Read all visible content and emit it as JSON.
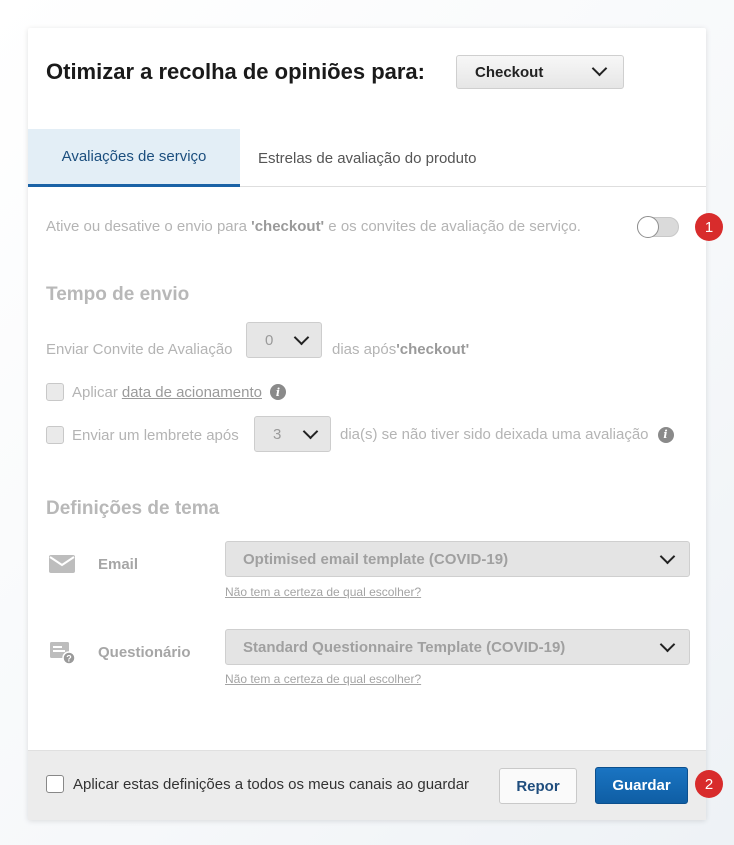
{
  "header": {
    "title": "Otimizar a recolha de opiniões para:",
    "channel_select": "Checkout"
  },
  "tabs": [
    {
      "label": "Avaliações de serviço"
    },
    {
      "label": "Estrelas de avaliação do produto"
    }
  ],
  "toggle_row": {
    "text_before": "Ative ou desative o envio para ",
    "bold": "'checkout'",
    "text_after": " e os convites de avaliação de serviço.",
    "enabled": false
  },
  "badges": {
    "first": "1",
    "second": "2"
  },
  "send_time": {
    "section_title": "Tempo de envio",
    "invite_label": "Enviar Convite de Avaliação",
    "invite_days": "0",
    "after_text": "dias após ",
    "after_bold": "'checkout'",
    "apply_label": "Aplicar ",
    "apply_link": "data de acionamento",
    "reminder_label": "Enviar um lembrete após",
    "reminder_days": "3",
    "reminder_after": "dia(s) se não tiver sido deixada uma avaliação"
  },
  "theme": {
    "section_title": "Definições de tema",
    "email_label": "Email",
    "email_template": "Optimised email template (COVID-19)",
    "email_help": "Não tem a certeza de qual escolher?",
    "questionnaire_label": "Questionário",
    "questionnaire_template": "Standard Questionnaire Template (COVID-19)",
    "questionnaire_help": "Não tem a certeza de qual escolher?"
  },
  "footer": {
    "apply_all_label": "Aplicar estas definições a todos os meus canais ao guardar",
    "reset_label": "Repor",
    "save_label": "Guardar"
  },
  "colors": {
    "accent": "#1a62a6",
    "save_button": "#1a74c2",
    "badge": "#d82c2c"
  }
}
